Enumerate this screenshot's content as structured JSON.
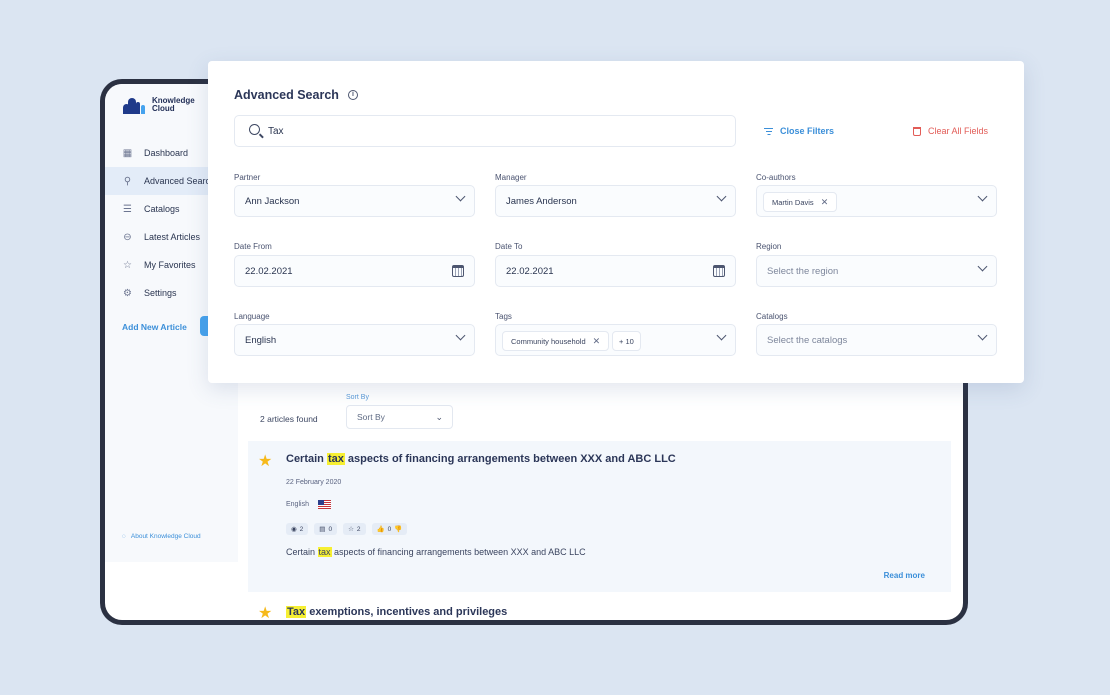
{
  "app": {
    "logo_line1": "Knowledge",
    "logo_line2": "Cloud",
    "brand_color": "#1f3a8a",
    "accent_color": "#3b8fd9"
  },
  "sidebar": {
    "items": [
      {
        "label": "Dashboard",
        "icon": "dashboard-icon",
        "active": false
      },
      {
        "label": "Advanced Search",
        "icon": "search-icon",
        "active": true
      },
      {
        "label": "Catalogs",
        "icon": "list-icon",
        "active": false
      },
      {
        "label": "Latest Articles",
        "icon": "minus-circle-icon",
        "active": false
      },
      {
        "label": "My Favorites",
        "icon": "star-icon",
        "active": false
      },
      {
        "label": "Settings",
        "icon": "gear-icon",
        "active": false
      }
    ],
    "add_article": "Add New Article",
    "about": "About Knowledge Cloud"
  },
  "search_panel": {
    "title": "Advanced Search",
    "query": "Tax",
    "close_filters": "Close Filters",
    "clear_all": "Clear All Fields",
    "fields": {
      "partner": {
        "label": "Partner",
        "value": "Ann Jackson"
      },
      "manager": {
        "label": "Manager",
        "value": "James Anderson"
      },
      "coauthors": {
        "label": "Co-authors",
        "chip": "Martin Davis"
      },
      "date_from": {
        "label": "Date From",
        "value": "22.02.2021"
      },
      "date_to": {
        "label": "Date To",
        "value": "22.02.2021"
      },
      "region": {
        "label": "Region",
        "placeholder": "Select the region"
      },
      "language": {
        "label": "Language",
        "value": "English"
      },
      "tags": {
        "label": "Tags",
        "chip": "Community household",
        "more": "+ 10"
      },
      "catalogs": {
        "label": "Catalogs",
        "placeholder": "Select the catalogs"
      }
    }
  },
  "results": {
    "count_text": "2 articles found",
    "sort_label": "Sort By",
    "sort_value": "Sort By",
    "articles": [
      {
        "title_pre": "Certain ",
        "title_hl": "tax",
        "title_post": " aspects of financing arrangements between XXX and ABC LLC",
        "date": "22 February 2020",
        "language": "English",
        "stats": {
          "views": "2",
          "comments": "0",
          "favorites": "2",
          "likes": "0"
        },
        "body_pre": "Certain ",
        "body_hl": "tax",
        "body_post": " aspects of financing arrangements between XXX and ABC LLC",
        "read_more": "Read more"
      },
      {
        "title_hl": "Tax",
        "title_post": " exemptions, incentives and privileges"
      }
    ]
  }
}
